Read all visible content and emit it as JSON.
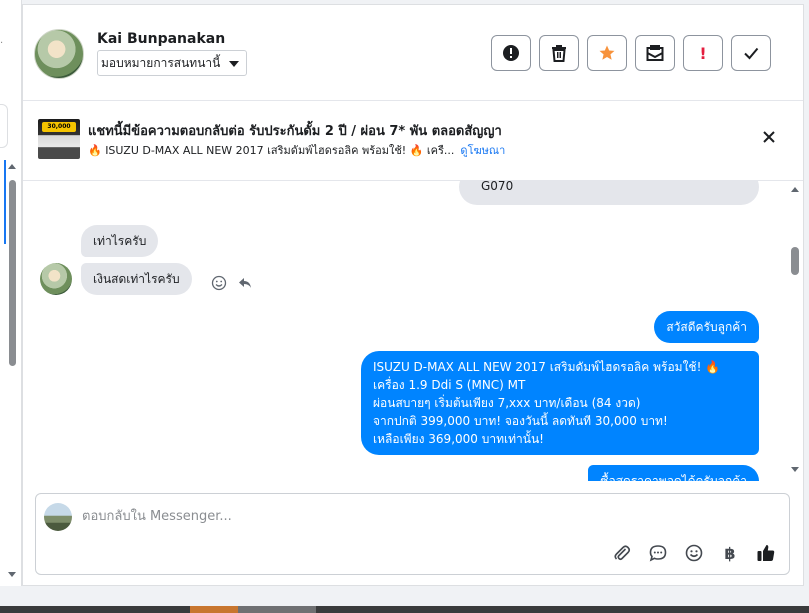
{
  "header": {
    "contact_name": "Kai Bunpanakan",
    "assign_label": "มอบหมายการสนทนานี้",
    "actions": [
      {
        "icon": "alert-circle-icon",
        "label": "Mark as spam"
      },
      {
        "icon": "trash-icon",
        "label": "Delete"
      },
      {
        "icon": "star-icon",
        "label": "Star",
        "color": "#f7923b"
      },
      {
        "icon": "mark-unread-icon",
        "label": "Mark as unread"
      },
      {
        "icon": "exclamation-icon",
        "label": "Follow up",
        "color": "#e41e3f"
      },
      {
        "icon": "check-icon",
        "label": "Mark as done"
      }
    ]
  },
  "ad": {
    "badge_text": "30,000",
    "title": "แชทนี้มีข้อความตอบกลับต่อ รับประกันดั้ม 2 ปี / ผ่อน 7* พัน ตลอดสัญญา",
    "subtitle": "🔥 ISUZU D-MAX ALL NEW 2017 เสริมดัมพ์ไฮดรอลิค พร้อมใช้! 🔥 เครื...",
    "link": "ดูโฆษณา"
  },
  "messages": {
    "partial_top": "G070",
    "in_1": "เท่าไรครับ",
    "in_2": "เงินสดเท่าไรครับ",
    "out_1": "สวัสดีครับลูกค้า",
    "out_2_lines": [
      "ISUZU D-MAX ALL NEW 2017 เสริมดัมพ์ไฮดรอลิค พร้อมใช้! 🔥",
      "เครื่อง 1.9 Ddi S (MNC) MT",
      "ผ่อนสบายๆ เริ่มต้นเพียง 7,xxx บาท/เดือน (84 งวด)",
      "จากปกติ 399,000 บาท! จองวันนี้ ลดทันที 30,000 บาท!",
      "เหลือเพียง 369,000 บาทเท่านั้น!"
    ],
    "out_3_partial": "ซื้อสดราคาพอดูได้ครับลูกค้า"
  },
  "composer": {
    "placeholder": "ตอบกลับใน Messenger...",
    "baht_symbol": "฿"
  },
  "colors": {
    "brand_blue": "#0084ff",
    "link_blue": "#1877f2",
    "incoming_bubble": "#e4e6eb",
    "star_orange": "#f7923b",
    "alert_red": "#e41e3f"
  }
}
